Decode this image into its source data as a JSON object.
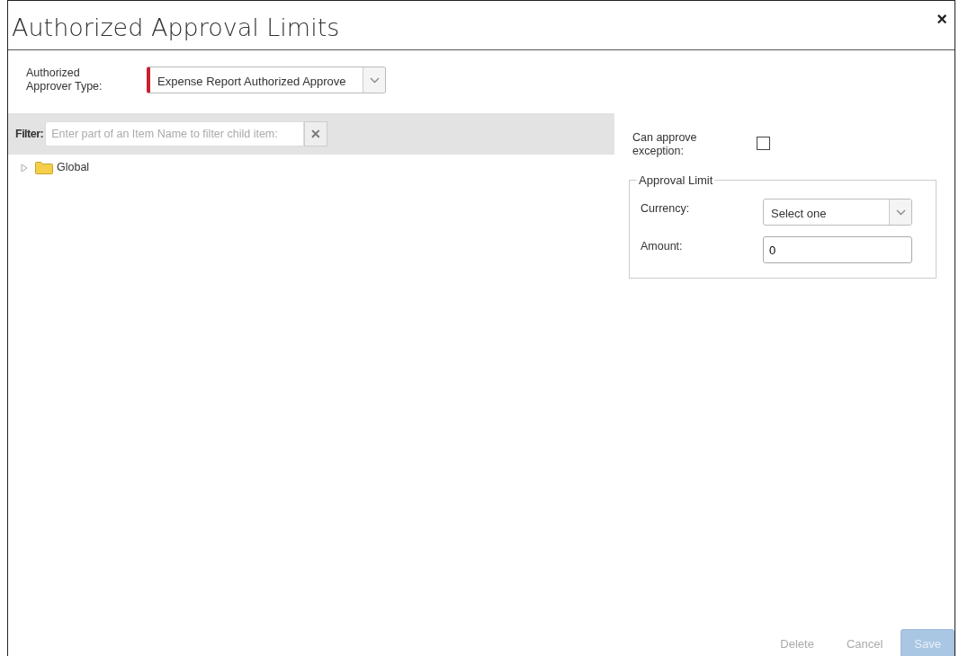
{
  "dialog": {
    "title": "Authorized Approval Limits",
    "close": "×"
  },
  "approver_type": {
    "label": "Authorized Approver Type:",
    "value": "Expense Report Authorized Approve",
    "required": true
  },
  "filter": {
    "label": "Filter:",
    "placeholder": "Enter part of an Item Name to filter child item:",
    "clear": "✕"
  },
  "tree": [
    {
      "label": "Global",
      "expanded": false
    }
  ],
  "can_approve_exception": {
    "label": "Can approve exception:",
    "checked": false
  },
  "approval_limit": {
    "legend": "Approval Limit",
    "currency_label": "Currency:",
    "currency_value": "Select one",
    "amount_label": "Amount:",
    "amount_value": "0"
  },
  "buttons": [
    {
      "label": "Delete",
      "kind": "link",
      "disabled": true
    },
    {
      "label": "Cancel",
      "kind": "link",
      "disabled": true
    },
    {
      "label": "Save",
      "kind": "primary",
      "disabled": true
    }
  ]
}
